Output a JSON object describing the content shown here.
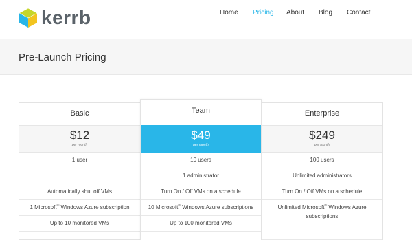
{
  "brand": {
    "name": "kerrb"
  },
  "nav": {
    "items": [
      {
        "label": "Home",
        "active": false
      },
      {
        "label": "Pricing",
        "active": true
      },
      {
        "label": "About",
        "active": false
      },
      {
        "label": "Blog",
        "active": false
      },
      {
        "label": "Contact",
        "active": false
      }
    ]
  },
  "page": {
    "title": "Pre-Launch Pricing"
  },
  "plans": [
    {
      "name": "Basic",
      "price": "$12",
      "period": "per month",
      "features": [
        "1 user",
        "",
        "Automatically shut off VMs",
        "1 Microsoft",
        "Up to 10 monitored VMs"
      ],
      "azure_suffix": "Windows Azure subscription"
    },
    {
      "name": "Team",
      "price": "$49",
      "period": "per month",
      "features": [
        "10 users",
        "1 administrator",
        "Turn On / Off VMs on a schedule",
        "10 Microsoft",
        "Up to 100 monitored VMs"
      ],
      "azure_suffix": "Windows Azure subscriptions"
    },
    {
      "name": "Enterprise",
      "price": "$249",
      "period": "per month",
      "features": [
        "100 users",
        "Unlimited administrators",
        "Turn On / Off VMs on a schedule",
        "Unlimited Microsoft",
        ""
      ],
      "azure_suffix": "Windows Azure subscriptions"
    }
  ],
  "registered_mark": "®",
  "colors": {
    "accent": "#29b6e8",
    "text": "#333333",
    "band": "#f6f6f6"
  }
}
